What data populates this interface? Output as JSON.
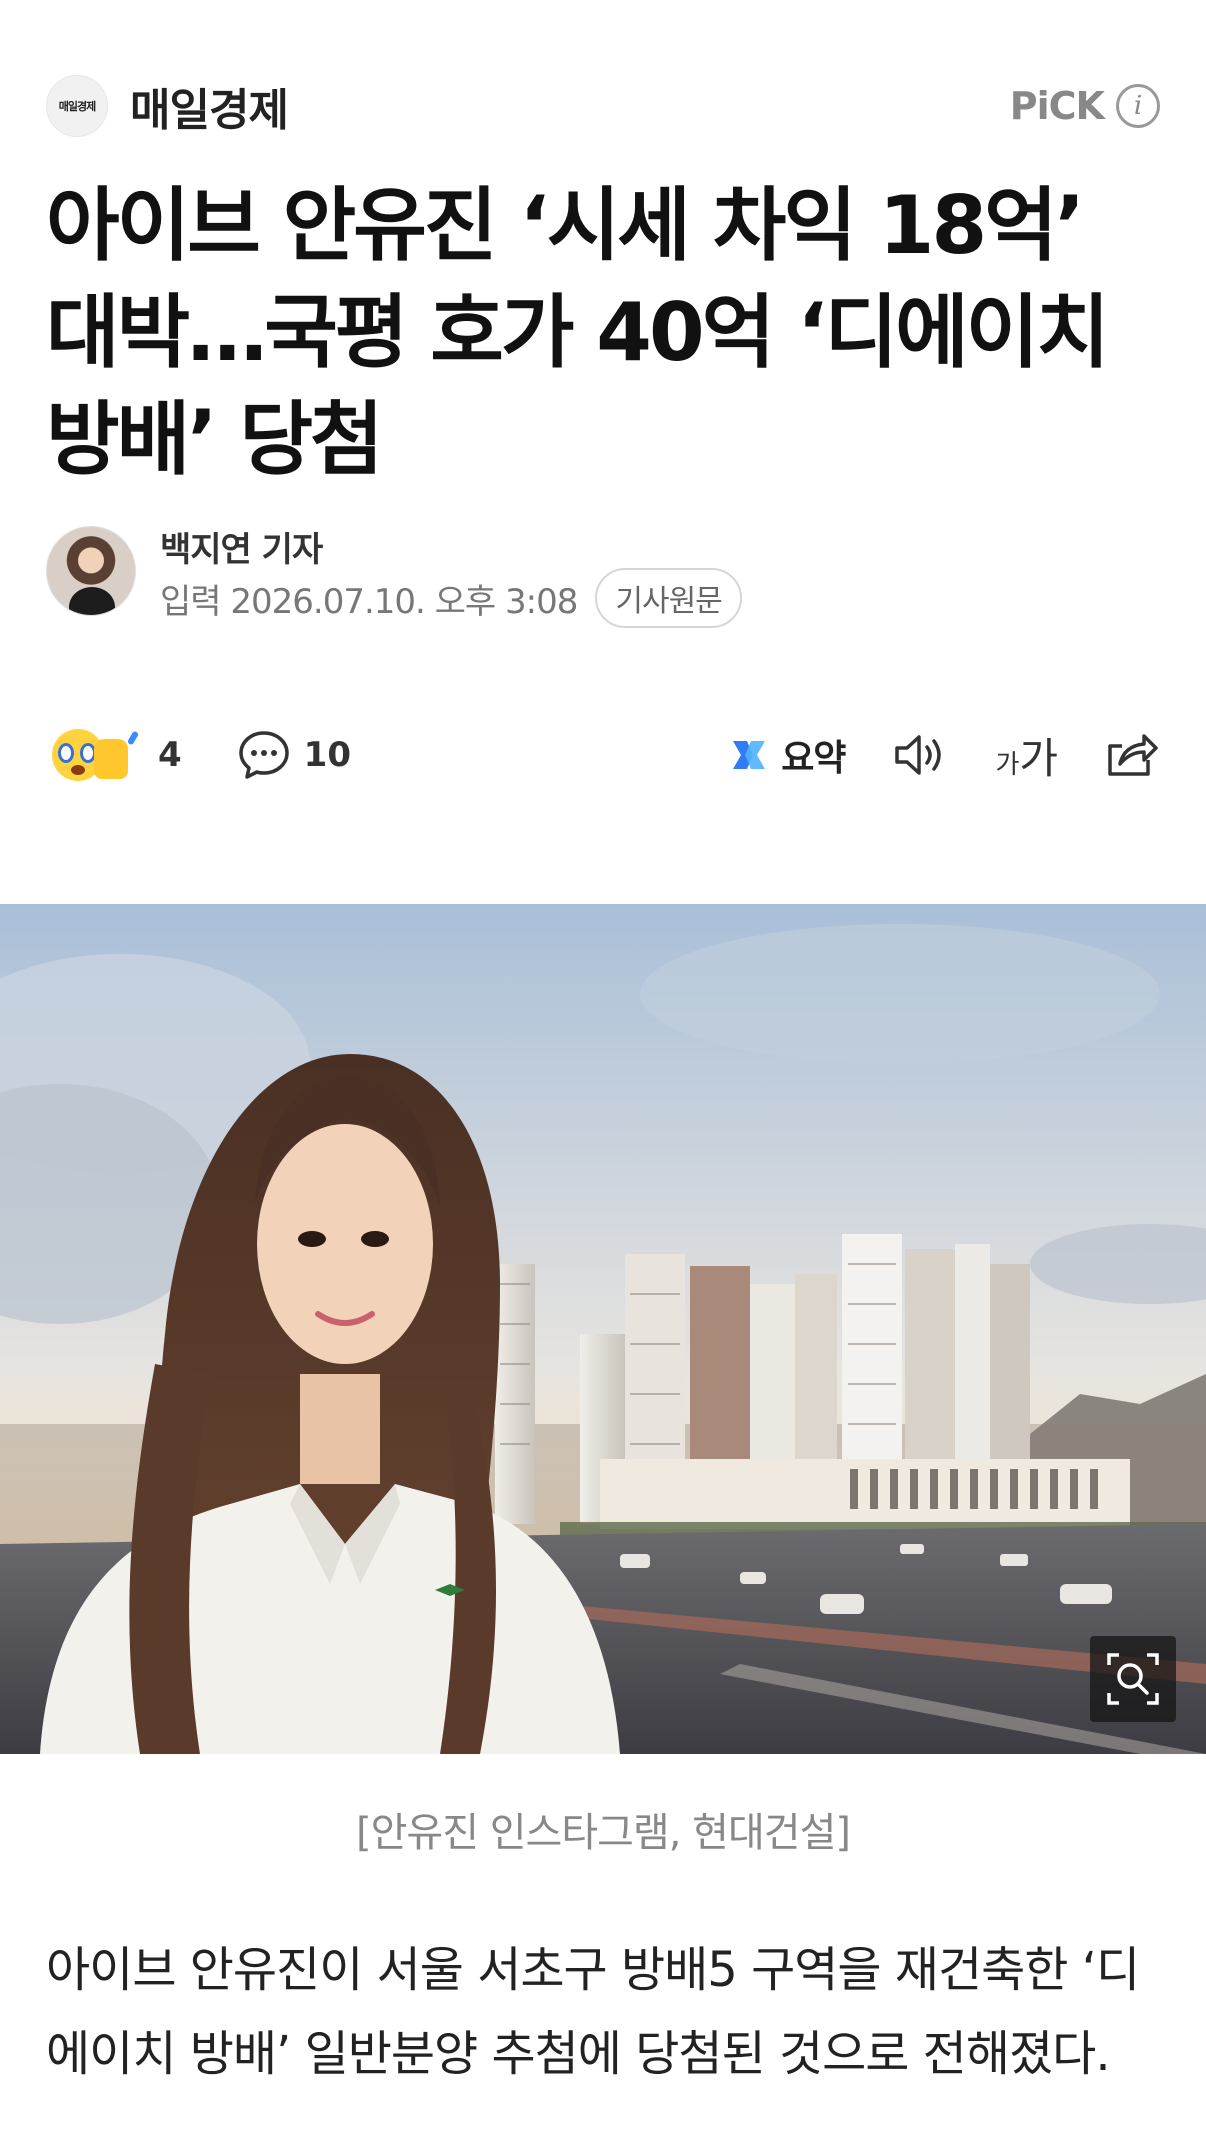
{
  "press": {
    "logo_text": "매일경제",
    "name": "매일경제",
    "pick_label": "PiCK",
    "info_icon": "info-icon"
  },
  "article": {
    "headline": "아이브 안유진 ‘시세 차익 18억’ 대박…국평 호가 40억 ‘디에이치 방배’ 당첨",
    "author": "백지연 기자",
    "date_label": "입력 2026.07.10. 오후 3:08",
    "original_button": "기사원문",
    "caption": "[안유진 인스타그램, 현대건설]",
    "body": "아이브 안유진이 서울 서초구 방배5 구역을 재건축한 ‘디에이치 방배’ 일반분양 추첨에 당첨된 것으로 전해졌다."
  },
  "toolbar": {
    "reaction_count": "4",
    "comment_count": "10",
    "summary_label": "요약",
    "fontsize_small": "가",
    "fontsize_big": "가",
    "icons": [
      "reaction-emoji-icon",
      "comment-icon",
      "summary-icon",
      "speaker-icon",
      "font-size-icon",
      "share-icon"
    ]
  },
  "colors": {
    "text": "#111111",
    "muted": "#777777",
    "summary_accent": "#2f7cf6",
    "pick_gray": "#888888"
  }
}
